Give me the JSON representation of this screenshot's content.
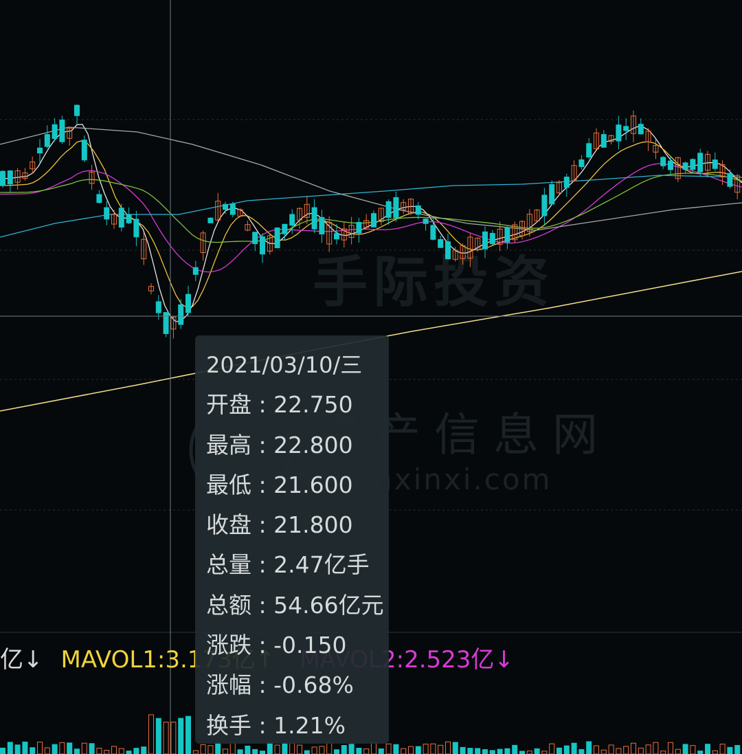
{
  "chart_data": {
    "type": "candlestick",
    "watermarks": [
      "手际投资",
      "资产信息网",
      "zichanxinxi.com"
    ],
    "volume_legend": {
      "prefix": "亿↓",
      "mavol1": "MAVOL1:3.173亿↑",
      "mavol2": "MAVOL2:2.523亿↓"
    },
    "tooltip": {
      "date": "2021/03/10/三",
      "rows": [
        {
          "label": "开盘",
          "value": "22.750"
        },
        {
          "label": "最高",
          "value": "22.800"
        },
        {
          "label": "最低",
          "value": "21.600"
        },
        {
          "label": "收盘",
          "value": "21.800"
        },
        {
          "label": "总量",
          "value": "2.47亿手"
        },
        {
          "label": "总额",
          "value": "54.66亿元"
        },
        {
          "label": "涨跌",
          "value": "-0.150"
        },
        {
          "label": "涨幅",
          "value": "-0.68%"
        },
        {
          "label": "换手",
          "value": "1.21%"
        }
      ]
    },
    "selected_candle": {
      "open": 22.75,
      "high": 22.8,
      "low": 21.6,
      "close": 21.8
    },
    "colors": {
      "up": "#e8703a",
      "down": "#16c6c6",
      "ma5": "#e6e6e6",
      "ma10": "#f0c43c",
      "ma20": "#d83ad8",
      "ma30": "#7ec43a",
      "ma60": "#2cb5d6",
      "ma120": "#a8a8a8",
      "ma250": "#f5e08a",
      "mavol1": "#f0d43a",
      "mavol2": "#d83ad8"
    }
  }
}
